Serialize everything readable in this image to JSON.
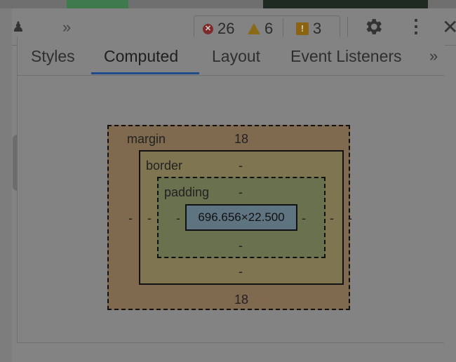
{
  "toolbar": {
    "more_tools": "»",
    "errors": "26",
    "warnings": "6",
    "issues": "3",
    "menu": "⋮",
    "close": "✕"
  },
  "tabs": [
    {
      "label": "Styles"
    },
    {
      "label": "Computed"
    },
    {
      "label": "Layout"
    },
    {
      "label": "Event Listeners"
    }
  ],
  "tabs_more": "»",
  "box_model": {
    "margin": {
      "label": "margin",
      "top": "18",
      "bottom": "18",
      "left": "-",
      "right": "-"
    },
    "border": {
      "label": "border",
      "top": "-",
      "bottom": "-",
      "left": "-",
      "right": "-"
    },
    "padding": {
      "label": "padding",
      "top": "-",
      "bottom": "-",
      "left": "-",
      "right": "-"
    },
    "content": "696.656×22.500"
  },
  "colors": {
    "margin": "#806a4f",
    "border": "#7f7551",
    "padding": "#69714f",
    "content": "#5f7481",
    "active_tab": "#1f4d8c"
  }
}
